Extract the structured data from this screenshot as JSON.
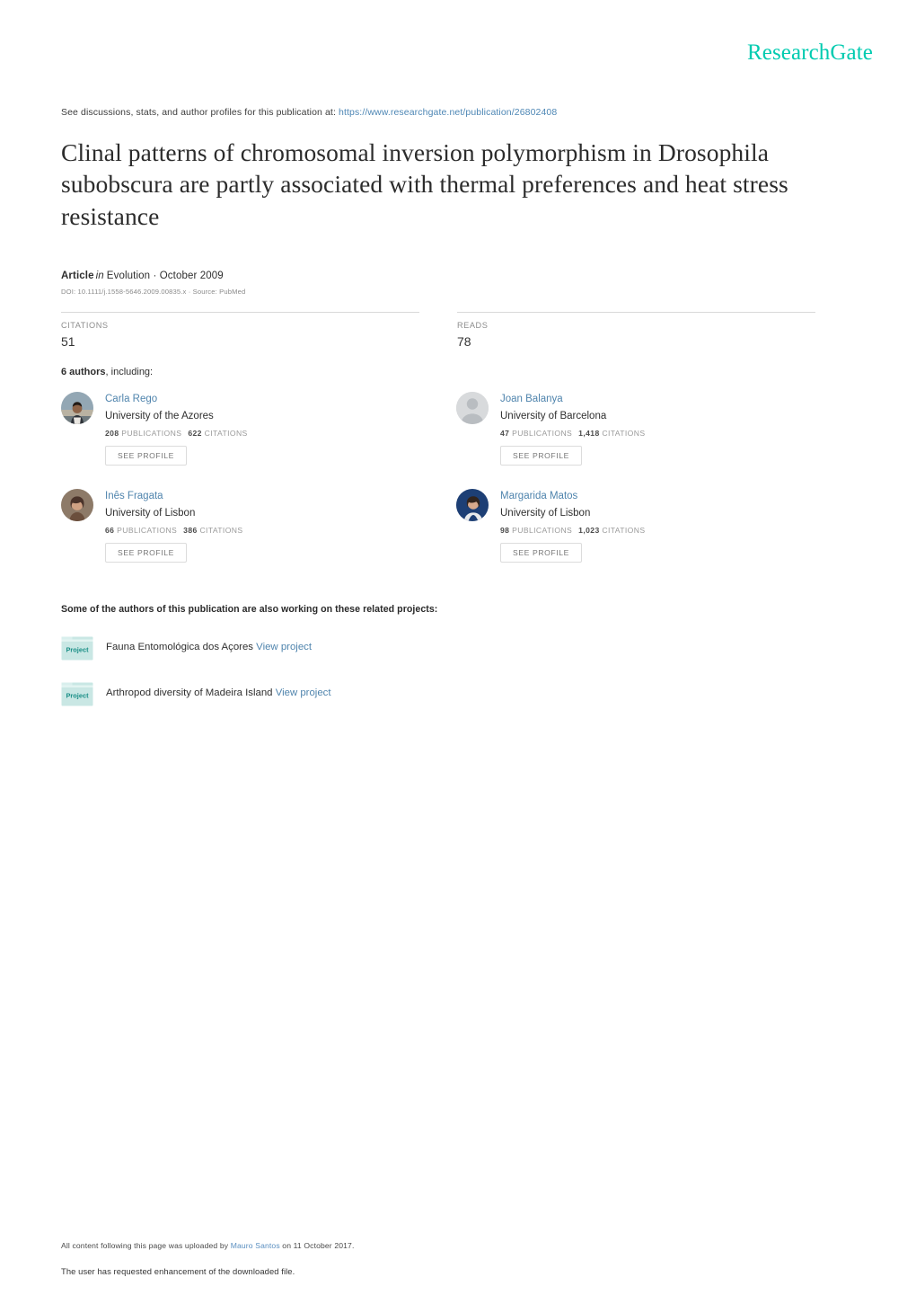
{
  "brand": {
    "logo_text": "ResearchGate",
    "logo_color": "#00cbb0"
  },
  "discussion": {
    "prefix": "See discussions, stats, and author profiles for this publication at:",
    "url": "https://www.researchgate.net/publication/26802408"
  },
  "publication": {
    "title": "Clinal patterns of chromosomal inversion polymorphism in Drosophila subobscura are partly associated with thermal preferences and heat stress resistance",
    "type_label": "Article",
    "in_word": "in",
    "venue": "Evolution · October 2009",
    "doi_line": "DOI: 10.1111/j.1558-5646.2009.00835.x · Source: PubMed"
  },
  "stats": {
    "citations_label": "CITATIONS",
    "citations_value": "51",
    "reads_label": "READS",
    "reads_value": "78"
  },
  "authors_section": {
    "count_text": "6 authors",
    "including_text": ", including:",
    "see_profile_label": "SEE PROFILE",
    "publications_label": "PUBLICATIONS",
    "citations_label": "CITATIONS",
    "authors": [
      {
        "name": "Carla Rego",
        "institution": "University of the Azores",
        "publications": "208",
        "citations": "622",
        "avatar": "photo-beach"
      },
      {
        "name": "Joan Balanya",
        "institution": "University of Barcelona",
        "publications": "47",
        "citations": "1,418",
        "avatar": "placeholder-silhouette"
      },
      {
        "name": "Inês Fragata",
        "institution": "University of Lisbon",
        "publications": "66",
        "citations": "386",
        "avatar": "photo-brown"
      },
      {
        "name": "Margarida Matos",
        "institution": "University of Lisbon",
        "publications": "98",
        "citations": "1,023",
        "avatar": "photo-blue"
      }
    ]
  },
  "projects_section": {
    "heading": "Some of the authors of this publication are also working on these related projects:",
    "icon_label": "Project",
    "view_label": "View project",
    "projects": [
      {
        "title": "Fauna Entomológica dos Açores"
      },
      {
        "title": "Arthropod diversity of Madeira Island"
      }
    ]
  },
  "footer": {
    "line1_prefix": "All content following this page was uploaded by",
    "uploader": "Mauro Santos",
    "line1_suffix": "on 11 October 2017.",
    "line2": "The user has requested enhancement of the downloaded file."
  }
}
